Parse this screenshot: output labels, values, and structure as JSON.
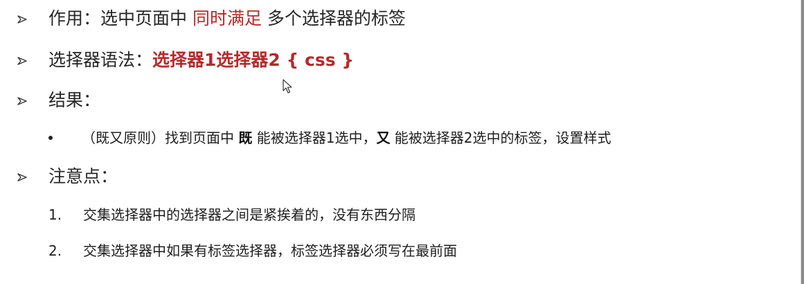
{
  "icons": {
    "bullet_arrow": "chevron-right-arrow-icon",
    "bullet_dot": "bullet-dot-icon",
    "cursor": "mouse-pointer-icon"
  },
  "colors": {
    "highlight_red": "#b52a2a",
    "text": "#262626"
  },
  "items": {
    "purpose": {
      "prefix": "作用：选中页面中 ",
      "highlight": "同时满足",
      "suffix": " 多个选择器的标签"
    },
    "syntax": {
      "prefix": "选择器语法：",
      "code": "选择器1选择器2 { css }"
    },
    "result": {
      "label": "结果：",
      "detail": {
        "part1": "（既又原则）找到页面中 ",
        "strong1": "既",
        "part2": " 能被选择器1选中，",
        "strong2": "又",
        "part3": " 能被选择器2选中的标签，设置样式"
      }
    },
    "notes": {
      "label": "注意点：",
      "list": [
        {
          "num": "1.",
          "text": "交集选择器中的选择器之间是紧挨着的，没有东西分隔"
        },
        {
          "num": "2.",
          "text": "交集选择器中如果有标签选择器，标签选择器必须写在最前面"
        }
      ]
    }
  }
}
